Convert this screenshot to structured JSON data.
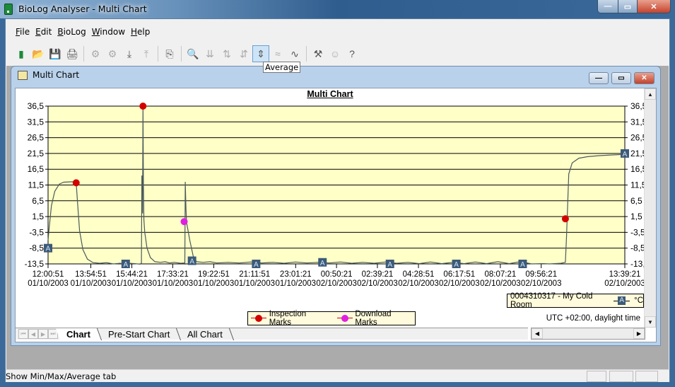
{
  "window": {
    "title": "BioLog Analyser - Multi Chart",
    "minimize": "—",
    "maximize": "▭",
    "close": "✕"
  },
  "menu": [
    {
      "label": "File",
      "ul": "F",
      "rest": "ile"
    },
    {
      "label": "Edit",
      "ul": "E",
      "rest": "dit"
    },
    {
      "label": "BioLog",
      "ul": "B",
      "rest": "ioLog"
    },
    {
      "label": "Window",
      "ul": "W",
      "rest": "indow"
    },
    {
      "label": "Help",
      "ul": "H",
      "rest": "elp"
    }
  ],
  "toolbar": {
    "buttons": [
      {
        "name": "new-icon",
        "glyph": "▮",
        "color": "#1d8a3a",
        "disabled": false
      },
      {
        "name": "open-folder-icon",
        "glyph": "📂",
        "disabled": false
      },
      {
        "name": "save-icon",
        "glyph": "💾",
        "disabled": false
      },
      {
        "name": "print-icon",
        "glyph": "🖨",
        "disabled": false
      },
      {
        "name": "properties-icon",
        "glyph": "⚙",
        "disabled": true
      },
      {
        "name": "logger-settings-icon",
        "glyph": "⚙",
        "disabled": true
      },
      {
        "name": "download-icon",
        "glyph": "⤓",
        "disabled": false
      },
      {
        "name": "upload-icon",
        "glyph": "⤒",
        "disabled": true
      },
      {
        "name": "copy-icon",
        "glyph": "⎘",
        "disabled": false
      },
      {
        "name": "zoom-out-icon",
        "glyph": "🔍",
        "disabled": true
      },
      {
        "name": "min-mark-icon",
        "glyph": "⇊",
        "disabled": true
      },
      {
        "name": "max-mark-icon",
        "glyph": "⇅",
        "disabled": true
      },
      {
        "name": "min-max-icon",
        "glyph": "⇵",
        "disabled": true
      },
      {
        "name": "average-icon",
        "glyph": "⇕",
        "disabled": false,
        "active": true
      },
      {
        "name": "smooth-icon",
        "glyph": "≈",
        "disabled": true
      },
      {
        "name": "line-chart-icon",
        "glyph": "∿",
        "disabled": false
      },
      {
        "name": "tools-icon",
        "glyph": "⚒",
        "disabled": false
      },
      {
        "name": "user-icon",
        "glyph": "☺",
        "disabled": true
      },
      {
        "name": "context-help-icon",
        "glyph": "?",
        "disabled": false
      }
    ],
    "tooltip": "Average"
  },
  "child_window": {
    "title": "Multi Chart"
  },
  "chart_data": {
    "type": "line",
    "title": "Multi Chart",
    "xlabel": "",
    "ylabel": "°C",
    "ylim": [
      -13.5,
      36.5
    ],
    "yticks": [
      "36,5",
      "31,5",
      "26,5",
      "21,5",
      "16,5",
      "11,5",
      "6,5",
      "1,5",
      "-3,5",
      "-8,5",
      "-13,5"
    ],
    "ytick_values": [
      36.5,
      31.5,
      26.5,
      21.5,
      16.5,
      11.5,
      6.5,
      1.5,
      -3.5,
      -8.5,
      -13.5
    ],
    "x_range_hours": [
      0,
      25.642
    ],
    "xticks": [
      {
        "t": 0.0,
        "time": "12:00:51",
        "date": "01/10/2003"
      },
      {
        "t": 1.9,
        "time": "13:54:51",
        "date": "01/10/2003"
      },
      {
        "t": 3.725,
        "time": "15:44:21",
        "date": "01/10/2003"
      },
      {
        "t": 5.542,
        "time": "17:33:21",
        "date": "01/10/2003"
      },
      {
        "t": 7.367,
        "time": "19:22:51",
        "date": "01/10/2003"
      },
      {
        "t": 9.183,
        "time": "21:11:51",
        "date": "01/10/2003"
      },
      {
        "t": 11.008,
        "time": "23:01:21",
        "date": "01/10/2003"
      },
      {
        "t": 12.825,
        "time": "00:50:21",
        "date": "02/10/2003"
      },
      {
        "t": 14.642,
        "time": "02:39:21",
        "date": "02/10/2003"
      },
      {
        "t": 16.467,
        "time": "04:28:51",
        "date": "02/10/2003"
      },
      {
        "t": 18.283,
        "time": "06:17:51",
        "date": "02/10/2003"
      },
      {
        "t": 20.108,
        "time": "08:07:21",
        "date": "02/10/2003"
      },
      {
        "t": 21.925,
        "time": "09:56:21",
        "date": "02/10/2003"
      },
      {
        "t": 25.642,
        "time": "13:39:21",
        "date": "02/10/2003"
      }
    ],
    "grid": true,
    "series": [
      {
        "name": "0004310317 - My Cold Room",
        "unit": "°C",
        "color": "#4a5a5a",
        "points": [
          [
            0,
            -6
          ],
          [
            0.05,
            -2
          ],
          [
            0.15,
            5
          ],
          [
            0.3,
            9.5
          ],
          [
            0.5,
            11.8
          ],
          [
            0.7,
            12.4
          ],
          [
            1.0,
            12.5
          ],
          [
            1.22,
            12.5
          ],
          [
            1.25,
            12.2
          ],
          [
            1.32,
            5
          ],
          [
            1.4,
            -3
          ],
          [
            1.55,
            -9
          ],
          [
            1.75,
            -12
          ],
          [
            2.0,
            -13.1
          ],
          [
            2.3,
            -13.3
          ],
          [
            2.6,
            -13.1
          ],
          [
            2.9,
            -13.5
          ],
          [
            3.2,
            -13.3
          ],
          [
            3.4,
            -13.5
          ],
          [
            3.6,
            -13.3
          ],
          [
            3.85,
            -13.4
          ],
          [
            4.1,
            -13.6
          ],
          [
            4.15,
            -13.2
          ],
          [
            4.17,
            14.5
          ],
          [
            4.2,
            2.5
          ],
          [
            4.22,
            36.5
          ],
          [
            4.24,
            11.5
          ],
          [
            4.26,
            0.5
          ],
          [
            4.3,
            -3.5
          ],
          [
            4.4,
            -8.5
          ],
          [
            4.55,
            -11.5
          ],
          [
            4.75,
            -12.8
          ],
          [
            5.0,
            -13.0
          ],
          [
            5.2,
            -12.8
          ],
          [
            5.4,
            -13.2
          ],
          [
            5.6,
            -13.0
          ],
          [
            5.9,
            -13.3
          ],
          [
            6.05,
            -13.2
          ],
          [
            6.08,
            -13.5
          ],
          [
            6.1,
            12.5
          ],
          [
            6.13,
            4
          ],
          [
            6.16,
            -0.5
          ],
          [
            6.2,
            -2
          ],
          [
            6.3,
            -6
          ],
          [
            6.45,
            -11
          ],
          [
            6.6,
            -12.8
          ],
          [
            6.9,
            -13.0
          ],
          [
            7.2,
            -12.8
          ],
          [
            7.5,
            -13.2
          ],
          [
            8,
            -13.0
          ],
          [
            8.5,
            -13.2
          ],
          [
            9,
            -12.9
          ],
          [
            9.5,
            -13.2
          ],
          [
            10,
            -13.0
          ],
          [
            10.5,
            -13.3
          ],
          [
            11,
            -12.9
          ],
          [
            11.5,
            -13.2
          ],
          [
            12,
            -13.0
          ],
          [
            12.5,
            -13.2
          ],
          [
            13,
            -12.9
          ],
          [
            13.5,
            -13.3
          ],
          [
            14,
            -13.0
          ],
          [
            14.5,
            -13.3
          ],
          [
            15,
            -12.9
          ],
          [
            15.5,
            -13.3
          ],
          [
            16,
            -13.0
          ],
          [
            16.5,
            -13.4
          ],
          [
            17,
            -12.9
          ],
          [
            17.5,
            -13.4
          ],
          [
            18,
            -13.0
          ],
          [
            18.5,
            -13.4
          ],
          [
            19,
            -12.9
          ],
          [
            19.5,
            -13.4
          ],
          [
            20,
            -12.8
          ],
          [
            20.5,
            -13.4
          ],
          [
            21,
            -12.8
          ],
          [
            21.5,
            -13.5
          ],
          [
            22,
            -13.4
          ],
          [
            22.3,
            -13.5
          ],
          [
            22.8,
            -13.3
          ],
          [
            23.0,
            -13.0
          ],
          [
            23.05,
            -5
          ],
          [
            23.1,
            5
          ],
          [
            23.15,
            15
          ],
          [
            23.3,
            18.5
          ],
          [
            23.6,
            20.0
          ],
          [
            24,
            20.5
          ],
          [
            24.5,
            20.8
          ],
          [
            25,
            21.0
          ],
          [
            25.642,
            21.2
          ]
        ],
        "avg_marker_label": "A",
        "avg_markers": [
          [
            0,
            -8.5
          ],
          [
            3.45,
            -13.5
          ],
          [
            6.4,
            -12.5
          ],
          [
            9.25,
            -13.5
          ],
          [
            12.2,
            -13.0
          ],
          [
            15.2,
            -13.5
          ],
          [
            18.15,
            -13.5
          ],
          [
            21.1,
            -13.5
          ],
          [
            25.642,
            21.5
          ]
        ]
      }
    ],
    "marker_series": [
      {
        "name": "Inspection Marks",
        "color": "#d40000",
        "points": [
          [
            1.25,
            12.2
          ],
          [
            4.22,
            36.5
          ],
          [
            23.0,
            0.8
          ]
        ]
      },
      {
        "name": "Download Marks",
        "color": "#e020e0",
        "points": [
          [
            6.05,
            -0.1
          ]
        ]
      }
    ],
    "legend": "bottom-center",
    "timezone_note": "UTC +02:00, daylight time"
  },
  "series_legend": {
    "label": "0004310317 - My Cold Room",
    "badge": "A",
    "unit": "°C"
  },
  "tabs": {
    "nav": [
      "⏮",
      "◀",
      "▶",
      "⏭"
    ],
    "items": [
      {
        "label": "Chart",
        "active": true
      },
      {
        "label": "Pre-Start Chart",
        "active": false
      },
      {
        "label": "All Chart",
        "active": false
      }
    ]
  },
  "scroll": {
    "up": "▲",
    "down": "▼",
    "left": "◀",
    "right": "▶"
  },
  "statusbar": {
    "text": "Show Min/Max/Average tab"
  }
}
